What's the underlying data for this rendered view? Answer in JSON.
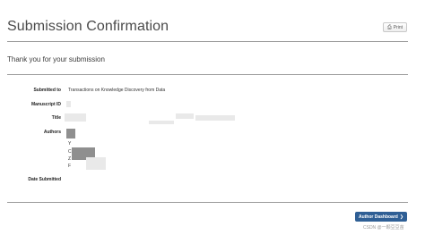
{
  "page": {
    "title": "Submission Confirmation",
    "subtitle": "Thank you for your submission"
  },
  "toolbar": {
    "print_label": "Print",
    "print_icon": "printer-icon"
  },
  "details": {
    "submitted_to_label": "Submitted to",
    "submitted_to_value": "Transactions on Knowledge Discovery from Data",
    "manuscript_id_label": "Manuscript ID",
    "title_label": "Title",
    "authors_label": "Authors",
    "author_initials": [
      "Y",
      "C",
      "Z",
      "F"
    ],
    "date_submitted_label": "Date Submitted"
  },
  "footer": {
    "dashboard_label": "Author Dashboard",
    "dashboard_icon": "chevron-right-icon"
  },
  "watermark": {
    "text": "CSDN @一颗豆豆苗"
  }
}
